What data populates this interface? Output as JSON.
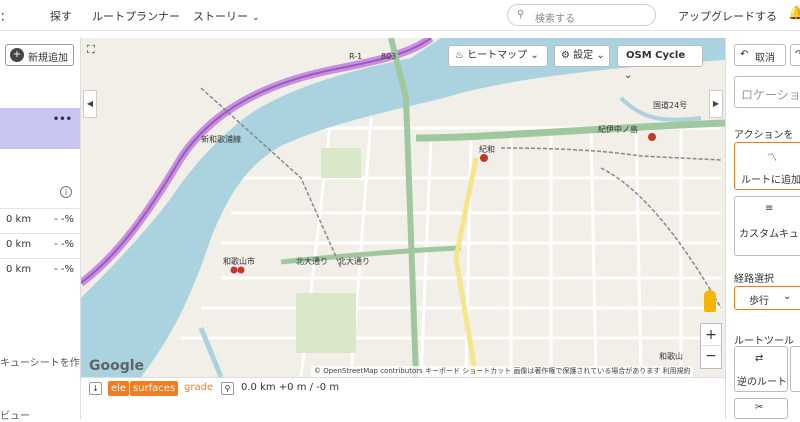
{
  "topnav": {
    "menu_label": "：",
    "explore": "探す",
    "planner": "ルートプランナー",
    "stories": "ストーリー",
    "search_placeholder": "検索する",
    "upgrade": "アップグレードする"
  },
  "left": {
    "add_new": "新規追加",
    "more": "•••",
    "info": "i",
    "stats": [
      {
        "km": "0 km",
        "pct": "- -%"
      },
      {
        "km": "0 km",
        "pct": "- -%"
      },
      {
        "km": "0 km",
        "pct": "- -%"
      }
    ],
    "cue_sheet": "キューシートを作",
    "review": "ビュー"
  },
  "map": {
    "heatmap": "ヒートマップ",
    "settings": "設定",
    "layer": "OSM Cycle",
    "labels": {
      "kiwa": "紀和",
      "kinokawa": "紀伊中ノ島",
      "wakayama_city": "和歌山市",
      "kitaodori": "北大通り",
      "kitaodori2": "北大通り",
      "r803": "803",
      "r1": "R-1",
      "wakayama": "和歌山",
      "kokudo24": "国道24号",
      "shinwakayama": "新和歌浦線",
      "google": "Google",
      "attribution": "© OpenStreetMap contributors   キーボード ショートカット   画像は著作権で保護されている場合があります   利用規約"
    }
  },
  "elevation": {
    "tag_ele": "ele",
    "tag_surfaces": "surfaces",
    "grade": "grade",
    "summary": "0.0 km +0 m / -0 m"
  },
  "right": {
    "cancel": "取消",
    "location_placeholder": "ロケーショ",
    "actions_title": "アクションをク",
    "add_to_route": "ルートに追加",
    "custom_cue": "カスタムキュー",
    "path_title": "経路選択",
    "mode": "歩行",
    "tools_title": "ルートツール",
    "reverse": "逆のルート"
  }
}
